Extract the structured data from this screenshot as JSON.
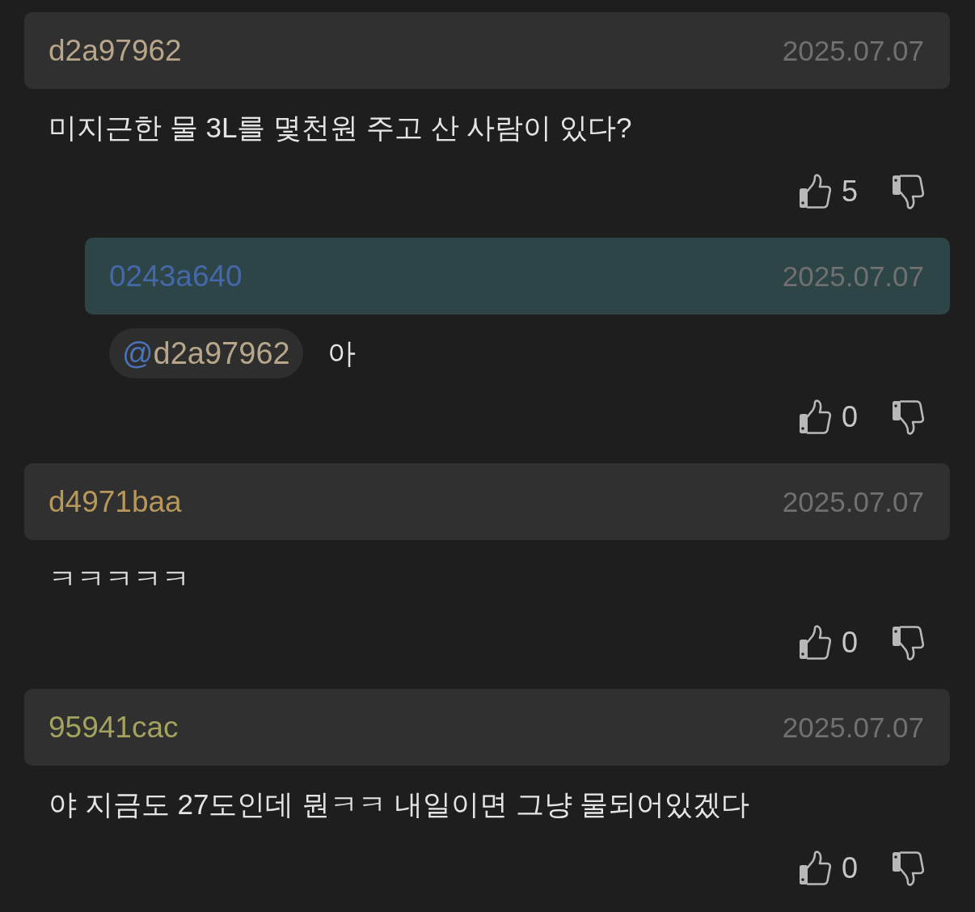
{
  "comments": [
    {
      "kind": "comment",
      "author": "d2a97962",
      "color": "#b8a68a",
      "date": "2025.07.07",
      "text": "미지근한 물 3L를 몇천원 주고 산 사람이 있다?",
      "likes": "5"
    },
    {
      "kind": "reply",
      "author": "0243a640",
      "color": "#4468a8",
      "date": "2025.07.07",
      "mention": {
        "symbol": "@",
        "user": "d2a97962",
        "color": "#b8a68a"
      },
      "text": "아",
      "likes": "0"
    },
    {
      "kind": "comment",
      "author": "d4971baa",
      "color": "#b8975a",
      "date": "2025.07.07",
      "text": "ㅋㅋㅋㅋㅋ",
      "likes": "0"
    },
    {
      "kind": "comment",
      "author": "95941cac",
      "color": "#a3a35e",
      "date": "2025.07.07",
      "text": "야 지금도 27도인데 뭔ㅋㅋ 내일이면 그냥 물되어있겠다",
      "likes": "0"
    }
  ]
}
